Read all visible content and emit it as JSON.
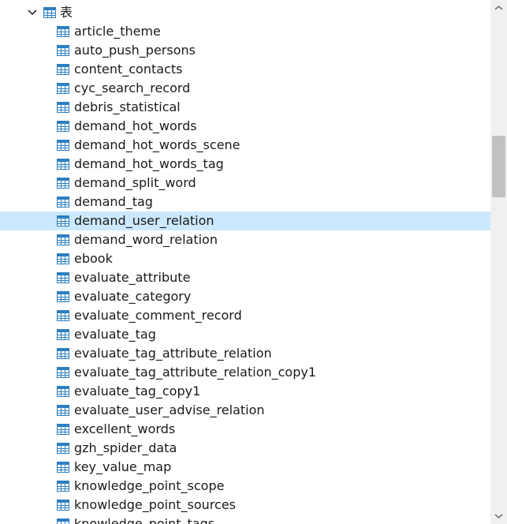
{
  "tree": {
    "folder": {
      "label": "表",
      "expanded": true
    },
    "selected_item": "demand_user_relation",
    "items": [
      "article_theme",
      "auto_push_persons",
      "content_contacts",
      "cyc_search_record",
      "debris_statistical",
      "demand_hot_words",
      "demand_hot_words_scene",
      "demand_hot_words_tag",
      "demand_split_word",
      "demand_tag",
      "demand_user_relation",
      "demand_word_relation",
      "ebook",
      "evaluate_attribute",
      "evaluate_category",
      "evaluate_comment_record",
      "evaluate_tag",
      "evaluate_tag_attribute_relation",
      "evaluate_tag_attribute_relation_copy1",
      "evaluate_tag_copy1",
      "evaluate_user_advise_relation",
      "excellent_words",
      "gzh_spider_data",
      "key_value_map",
      "knowledge_point_scope",
      "knowledge_point_sources",
      "knowledge_point_tags"
    ]
  },
  "colors": {
    "selection": "#cce8ff",
    "icon": "#2d7fc1",
    "scrollbar_track": "#f0f0f0",
    "scrollbar_thumb": "#c1c1c1"
  }
}
